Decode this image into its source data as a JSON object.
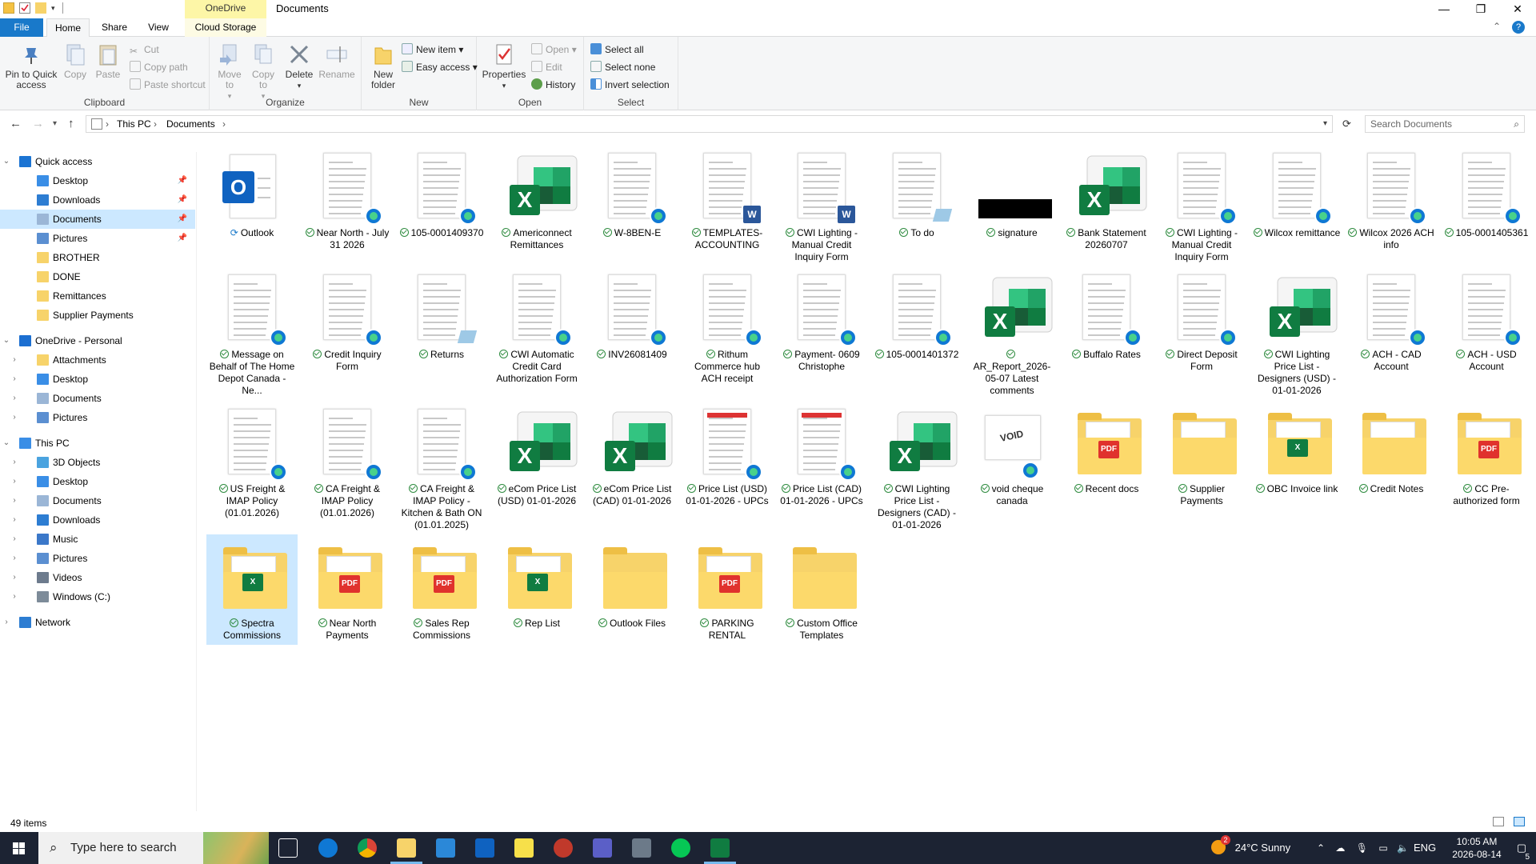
{
  "window": {
    "title": "Documents",
    "context_tab_group": "OneDrive"
  },
  "tabs": [
    {
      "label": "File"
    },
    {
      "label": "Home"
    },
    {
      "label": "Share"
    },
    {
      "label": "View"
    },
    {
      "label": "Cloud Storage"
    }
  ],
  "ribbon": {
    "clipboard": {
      "label": "Clipboard",
      "pin_to_quick_access": "Pin to Quick access",
      "copy": "Copy",
      "paste": "Paste",
      "cut": "Cut",
      "copy_path": "Copy path",
      "paste_shortcut": "Paste shortcut"
    },
    "organize": {
      "label": "Organize",
      "move_to": "Move to",
      "copy_to": "Copy to",
      "delete": "Delete",
      "rename": "Rename"
    },
    "new": {
      "label": "New",
      "new_folder": "New folder",
      "new_item": "New item",
      "easy_access": "Easy access"
    },
    "open": {
      "label": "Open",
      "properties": "Properties",
      "open": "Open",
      "edit": "Edit",
      "history": "History"
    },
    "select": {
      "label": "Select",
      "select_all": "Select all",
      "select_none": "Select none",
      "invert_selection": "Invert selection"
    }
  },
  "address": {
    "breadcrumbs": [
      "This PC",
      "Documents"
    ],
    "search_placeholder": "Search Documents"
  },
  "nav": {
    "quick_access": {
      "label": "Quick access",
      "items": [
        {
          "label": "Desktop",
          "pinned": true
        },
        {
          "label": "Downloads",
          "pinned": true
        },
        {
          "label": "Documents",
          "pinned": true,
          "selected": true
        },
        {
          "label": "Pictures",
          "pinned": true
        },
        {
          "label": "BROTHER"
        },
        {
          "label": "DONE"
        },
        {
          "label": "Remittances"
        },
        {
          "label": "Supplier Payments"
        }
      ]
    },
    "onedrive": {
      "label": "OneDrive - Personal",
      "items": [
        {
          "label": "Attachments"
        },
        {
          "label": "Desktop"
        },
        {
          "label": "Documents"
        },
        {
          "label": "Pictures"
        }
      ]
    },
    "this_pc": {
      "label": "This PC",
      "items": [
        {
          "label": "3D Objects"
        },
        {
          "label": "Desktop"
        },
        {
          "label": "Documents"
        },
        {
          "label": "Downloads"
        },
        {
          "label": "Music"
        },
        {
          "label": "Pictures"
        },
        {
          "label": "Videos"
        },
        {
          "label": "Windows (C:)"
        }
      ]
    },
    "network": {
      "label": "Network"
    }
  },
  "files": [
    {
      "name": "Outlook",
      "type": "outlook",
      "status": "syncing"
    },
    {
      "name": "Near North - July 31 2026",
      "type": "doc-edge",
      "status": "ok"
    },
    {
      "name": "105-0001409370",
      "type": "doc-edge",
      "status": "ok"
    },
    {
      "name": "Americonnect Remittances",
      "type": "excel",
      "status": "ok"
    },
    {
      "name": "W-8BEN-E",
      "type": "doc-edge",
      "status": "ok"
    },
    {
      "name": "TEMPLATES-ACCOUNTING",
      "type": "doc-word",
      "status": "ok"
    },
    {
      "name": "CWI Lighting - Manual Credit Inquiry Form",
      "type": "doc-word",
      "status": "ok"
    },
    {
      "name": "To do",
      "type": "doc-note",
      "status": "ok"
    },
    {
      "name": "signature",
      "type": "image-black",
      "status": "ok"
    },
    {
      "name": "Bank Statement 20260707",
      "type": "excel",
      "status": "ok"
    },
    {
      "name": "CWI Lighting - Manual Credit Inquiry Form",
      "type": "doc-edge",
      "status": "ok"
    },
    {
      "name": "Wilcox remittance",
      "type": "doc-edge",
      "status": "ok"
    },
    {
      "name": "Wilcox 2026 ACH info",
      "type": "doc-edge",
      "status": "ok"
    },
    {
      "name": "105-0001405361",
      "type": "doc-edge",
      "status": "ok"
    },
    {
      "name": "Message on Behalf of The Home Depot Canada - Ne...",
      "type": "doc-edge",
      "status": "ok"
    },
    {
      "name": "Credit Inquiry Form",
      "type": "doc-edge",
      "status": "ok"
    },
    {
      "name": "Returns",
      "type": "doc-note",
      "status": "ok"
    },
    {
      "name": "CWI Automatic Credit Card Authorization Form",
      "type": "doc-edge",
      "status": "ok"
    },
    {
      "name": "INV26081409",
      "type": "doc-edge",
      "status": "ok"
    },
    {
      "name": "Rithum Commerce hub ACH receipt",
      "type": "doc-edge",
      "status": "ok"
    },
    {
      "name": "Payment- 0609 Christophe",
      "type": "doc-edge",
      "status": "ok"
    },
    {
      "name": "105-0001401372",
      "type": "doc-edge",
      "status": "ok"
    },
    {
      "name": "AR_Report_2026-05-07 Latest comments",
      "type": "excel",
      "status": "ok"
    },
    {
      "name": "Buffalo Rates",
      "type": "doc-edge",
      "status": "ok"
    },
    {
      "name": "Direct Deposit Form",
      "type": "doc-edge",
      "status": "ok"
    },
    {
      "name": "CWI Lighting Price List - Designers (USD) - 01-01-2026",
      "type": "excel",
      "status": "ok"
    },
    {
      "name": "ACH - CAD Account",
      "type": "doc-edge",
      "status": "ok"
    },
    {
      "name": "ACH - USD Account",
      "type": "doc-edge",
      "status": "ok"
    },
    {
      "name": "US Freight & IMAP Policy (01.01.2026)",
      "type": "doc-edge",
      "status": "ok"
    },
    {
      "name": "CA Freight & IMAP Policy (01.01.2026)",
      "type": "doc-edge",
      "status": "ok"
    },
    {
      "name": "CA Freight & IMAP Policy - Kitchen & Bath ON (01.01.2025)",
      "type": "doc-edge",
      "status": "ok"
    },
    {
      "name": "eCom Price List (USD) 01-01-2026",
      "type": "excel",
      "status": "ok"
    },
    {
      "name": "eCom Price List (CAD) 01-01-2026",
      "type": "excel",
      "status": "ok"
    },
    {
      "name": "Price List (USD) 01-01-2026 - UPCs",
      "type": "doc-red-edge",
      "status": "ok"
    },
    {
      "name": "Price List (CAD) 01-01-2026 - UPCs",
      "type": "doc-red-edge",
      "status": "ok"
    },
    {
      "name": "CWI Lighting Price List - Designers (CAD) - 01-01-2026",
      "type": "excel",
      "status": "ok"
    },
    {
      "name": "void cheque canada",
      "type": "doc-void",
      "status": "ok"
    },
    {
      "name": "Recent docs",
      "type": "folder-pdf",
      "status": "ok"
    },
    {
      "name": "Supplier Payments",
      "type": "folder-doc",
      "status": "ok"
    },
    {
      "name": "OBC Invoice link",
      "type": "folder-excel",
      "status": "ok"
    },
    {
      "name": "Credit Notes",
      "type": "folder-doc",
      "status": "ok"
    },
    {
      "name": "CC Pre-authorized form",
      "type": "folder-pdf",
      "status": "ok"
    },
    {
      "name": "Spectra Commissions",
      "type": "folder-excel",
      "status": "ok",
      "selected": true
    },
    {
      "name": "Near North Payments",
      "type": "folder-pdf",
      "status": "ok"
    },
    {
      "name": "Sales Rep Commissions",
      "type": "folder-pdf",
      "status": "ok"
    },
    {
      "name": "Rep List",
      "type": "folder-excel",
      "status": "ok"
    },
    {
      "name": "Outlook Files",
      "type": "folder",
      "status": "ok"
    },
    {
      "name": "PARKING RENTAL",
      "type": "folder-pdf",
      "status": "ok"
    },
    {
      "name": "Custom Office Templates",
      "type": "folder",
      "status": "ok"
    }
  ],
  "status_bar": {
    "item_count": "49 items"
  },
  "taskbar": {
    "search_placeholder": "Type here to search",
    "weather": "24°C  Sunny",
    "weather_badge": "2",
    "language": "ENG",
    "time": "10:05 AM",
    "date": "2026-08-14",
    "notification_count": "5",
    "apps": [
      "task-view",
      "edge",
      "chrome",
      "file-explorer",
      "store",
      "outlook",
      "sticky-notes",
      "snipping",
      "teams",
      "calculator",
      "line",
      "excel"
    ]
  },
  "colors": {
    "accent": "#1979ca",
    "selection": "#cce8ff",
    "excel_green": "#107c41",
    "folder": "#f7d36a",
    "taskbar": "#1c2333",
    "sync_ok": "#2e8b3f"
  }
}
